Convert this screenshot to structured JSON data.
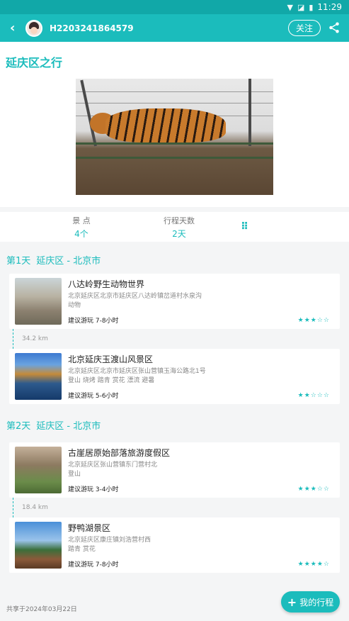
{
  "status_bar": {
    "time": "11:29"
  },
  "header": {
    "user_id": "H2203241864579",
    "follow_label": "关注"
  },
  "trip": {
    "title": "延庆区之行"
  },
  "stats": {
    "spots_label": "景  点",
    "spots_value": "4个",
    "days_label": "行程天数",
    "days_value": "2天"
  },
  "days": [
    {
      "day": "第1天",
      "region": "延庆区 - 北京市",
      "places": [
        {
          "name": "八达岭野生动物世界",
          "address": "北京延庆区北京市延庆区八达岭镇岔道村水泉沟",
          "tags": "动物",
          "suggest": "建议游玩 7-8小时",
          "stars": "★★★☆☆"
        },
        {
          "name": "北京延庆玉渡山风景区",
          "address": "北京延庆区北京市延庆区张山营镇玉海公路北1号",
          "tags": "登山 烧烤 踏青 赏花 漂流 避暑",
          "suggest": "建议游玩 5-6小时",
          "stars": "★★☆☆☆"
        }
      ],
      "distance": "34.2 km"
    },
    {
      "day": "第2天",
      "region": "延庆区 - 北京市",
      "places": [
        {
          "name": "古崖居原始部落旅游度假区",
          "address": "北京延庆区张山营镇东门营村北",
          "tags": "登山",
          "suggest": "建议游玩 3-4小时",
          "stars": "★★★☆☆"
        },
        {
          "name": "野鸭湖景区",
          "address": "北京延庆区康庄镇刘浩营村西",
          "tags": "踏青 赏花",
          "suggest": "建议游玩 7-8小时",
          "stars": "★★★★☆"
        }
      ],
      "distance": "18.4 km"
    }
  ],
  "footer": {
    "shared_text": "共享于2024年03月22日"
  },
  "fab": {
    "label": "我的行程",
    "icon": "plus-icon"
  },
  "colors": {
    "accent": "#1bbcbc",
    "status_bar": "#11a8a8"
  }
}
